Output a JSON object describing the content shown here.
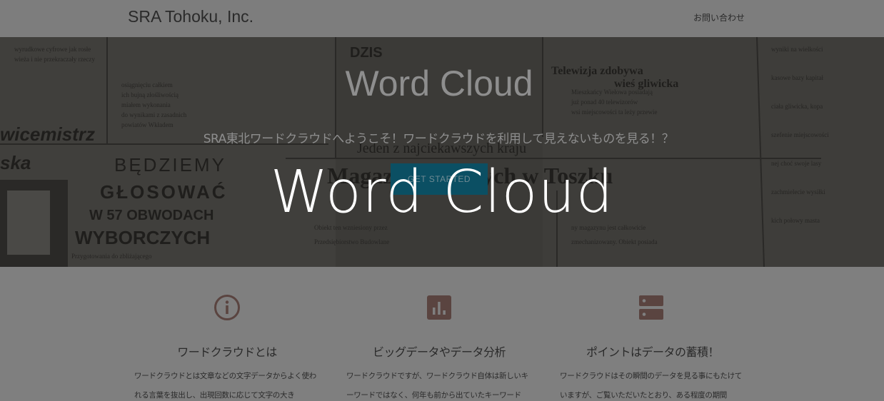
{
  "navbar": {
    "brand": "SRA Tohoku, Inc.",
    "contact_link": "お問い合わせ"
  },
  "hero": {
    "title": "Word Cloud",
    "subtitle": "SRA東北ワードクラウドへようこそ！ワードクラウドを利用して見えないものを見る！？",
    "cta_label": "GET STARTED",
    "background_newspaper_text": {
      "dzis": "DZIS",
      "telewizja": "Telewizja zdobywa",
      "gliwicka": "wieś gliwicka",
      "wicemistrz": "wicemistrz",
      "ska": "ska",
      "bedziemy": "BĘDZIEMY",
      "glosowac": "GŁOSOWAĆ",
      "obwodach": "W 57 OBWODACH",
      "wyborczych": "WYBORCZYCH",
      "magazyn": "Magazyn surowych w Toszku",
      "jeden": "Jeden z najciekawszych kraju"
    }
  },
  "features": [
    {
      "icon": "info-icon",
      "title": "ワードクラウドとは",
      "text": "ワードクラウドとは文章などの文字データからよく使われる言葉を抜出し、出現回数に応じて文字の大き"
    },
    {
      "icon": "bar-chart-icon",
      "title": "ビッグデータやデータ分析",
      "text": "ワードクラウドですが、ワードクラウド自体は新しいキーワードではなく、何年も前から出ていたキーワード"
    },
    {
      "icon": "storage-icon",
      "title": "ポイントはデータの蓄積！",
      "text": "ワードクラウドはその瞬間のデータを見る事にもたけていますが、ご覧いただいたとおり、ある程度の期間"
    }
  ],
  "overlay": {
    "text": "Word Cloud"
  },
  "colors": {
    "dim_background": "#7f7f7f",
    "cta_background": "#0b4f63",
    "icon_color": "#5a4440",
    "overlay_text": "#ffffff"
  }
}
